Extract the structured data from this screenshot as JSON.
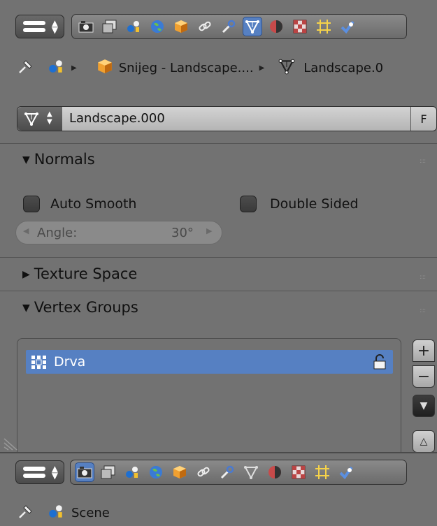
{
  "context_tabs": [
    {
      "icon": "render-icon",
      "label": "Render"
    },
    {
      "icon": "render-layers-icon",
      "label": "Render Layers"
    },
    {
      "icon": "scene-icon",
      "label": "Scene"
    },
    {
      "icon": "world-icon",
      "label": "World"
    },
    {
      "icon": "object-icon",
      "label": "Object"
    },
    {
      "icon": "constraints-icon",
      "label": "Constraints"
    },
    {
      "icon": "modifiers-icon",
      "label": "Modifiers"
    },
    {
      "icon": "data-icon",
      "label": "Data"
    },
    {
      "icon": "material-icon",
      "label": "Material"
    },
    {
      "icon": "texture-icon",
      "label": "Texture"
    },
    {
      "icon": "particles-icon",
      "label": "Particles"
    },
    {
      "icon": "physics-icon",
      "label": "Physics"
    }
  ],
  "breadcrumb": {
    "object": "Snijeg - Landscape....",
    "mesh": "Landscape.0"
  },
  "datablock": {
    "name": "Landscape.000",
    "fake_user": "F"
  },
  "normals": {
    "title": "Normals",
    "auto_smooth": "Auto Smooth",
    "double_sided": "Double Sided",
    "angle_label": "Angle:",
    "angle_value": "30°"
  },
  "texture_space": {
    "title": "Texture Space"
  },
  "vertex_groups": {
    "title": "Vertex Groups",
    "items": [
      {
        "name": "Drva"
      }
    ]
  },
  "bottom": {
    "breadcrumb_scene": "Scene"
  },
  "colors": {
    "active": "#5680c2",
    "panel_bg": "#727272"
  }
}
